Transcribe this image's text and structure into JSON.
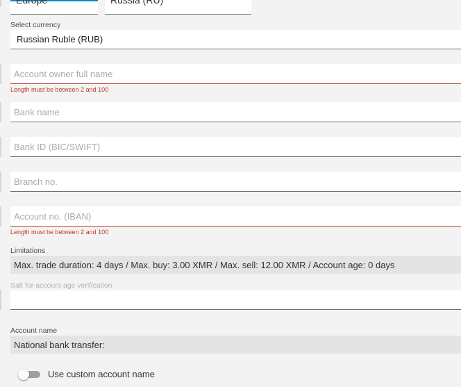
{
  "top": {
    "region_value": "Europe",
    "country_value": "Russia (RU)"
  },
  "currency": {
    "label": "Select currency",
    "value": "Russian Ruble (RUB)"
  },
  "account_owner": {
    "placeholder": "Account owner full name",
    "error": "Length must be between 2 and 100"
  },
  "bank_name": {
    "placeholder": "Bank name"
  },
  "bank_id": {
    "placeholder": "Bank ID (BIC/SWIFT)"
  },
  "branch_no": {
    "placeholder": "Branch no."
  },
  "account_no": {
    "placeholder": "Account no. (IBAN)",
    "error": "Length must be between 2 and 100"
  },
  "limitations": {
    "label": "Limitations",
    "value": "Max. trade duration: 4 days / Max. buy: 3.00 XMR / Max. sell: 12.00 XMR / Account age: 0 days"
  },
  "salt": {
    "label": "Salt for account age verification",
    "value": ""
  },
  "account_name": {
    "label": "Account name",
    "value": "National bank transfer:"
  },
  "custom_name_toggle": {
    "label": "Use custom account name",
    "checked": false
  },
  "colors": {
    "accent": "#0f86c9",
    "error": "#c0392b",
    "background": "#f3f3f3",
    "readonly": "#e4e4e4"
  }
}
